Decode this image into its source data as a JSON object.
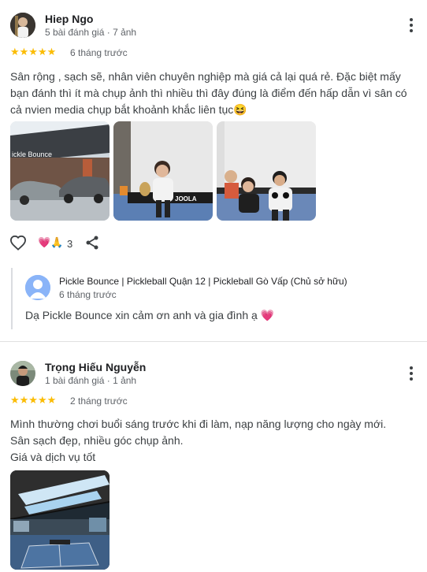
{
  "reviews": [
    {
      "author": "Hiep Ngo",
      "meta": "5 bài đánh giá · 7 ảnh",
      "stars": "★★★★★",
      "when": "6 tháng trước",
      "text_line1": "Sân rộng , sạch sẽ, nhân viên chuyên nghiệp mà giá cả lại quá rẻ. Đặc biệt mấy",
      "text_line2": "bạn đánh thì ít mà chụp ảnh thì nhiều thì đây đúng là điểm đến hấp dẫn vì sân có",
      "text_line3": "cả nvien media chụp bắt khoảnh khắc liên tục😆",
      "photo1_sign": "ickle Bounce",
      "photo2_sign": "JOOLA",
      "reaction_emoji": "💗🙏",
      "reaction_count": "3",
      "owner": {
        "name": "Pickle Bounce | Pickleball Quận 12 | Pickleball Gò Vấp (Chủ sở hữu)",
        "when": "6 tháng trước",
        "text": "Dạ Pickle Bounce xin cảm ơn anh và gia đình ạ 💗"
      }
    },
    {
      "author": "Trọng Hiếu Nguyễn",
      "meta": "1 bài đánh giá · 1 ảnh",
      "stars": "★★★★★",
      "when": "2 tháng trước",
      "text_line1": "Mình thường chơi buổi sáng trước khi đi làm, nạp năng lượng cho ngày mới.",
      "text_line2": "Sân sạch đẹp, nhiều góc chụp ảnh.",
      "text_line3": "Giá và dịch vụ tốt"
    }
  ],
  "icons": {
    "like": "heart-outline-icon",
    "share": "share-icon",
    "more": "more-vertical-icon",
    "owner_avatar": "person-icon"
  },
  "colors": {
    "star": "#fbbc04",
    "owner_avatar_bg": "#8ab4f8",
    "divider": "#e0e0e0"
  }
}
